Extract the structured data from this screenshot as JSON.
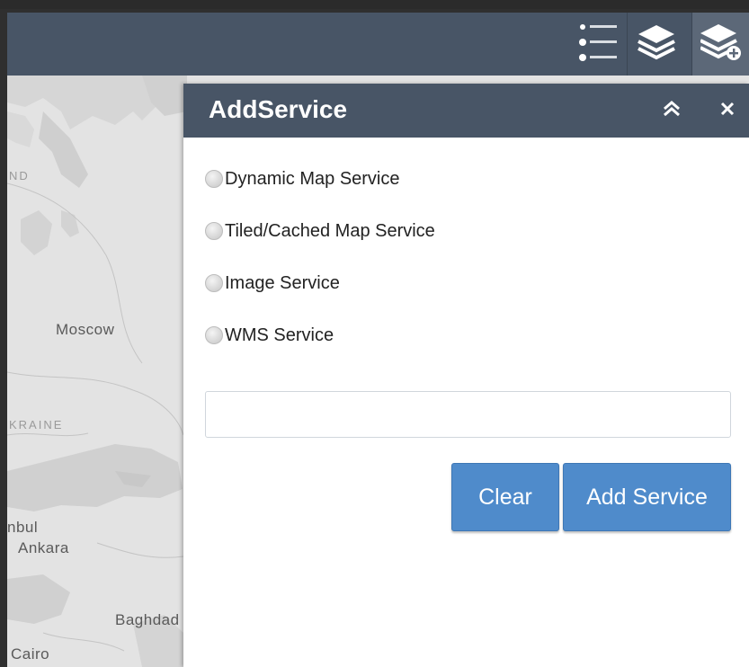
{
  "toolbar": {
    "buttons": [
      {
        "icon": "legend-list-icon"
      },
      {
        "icon": "layers-icon"
      },
      {
        "icon": "add-layer-icon",
        "active": true
      }
    ]
  },
  "map": {
    "labels": [
      "ND",
      "Moscow",
      "KRAINE",
      "nbul",
      "Ankara",
      "Baghdad",
      "Cairo"
    ]
  },
  "panel": {
    "title": "AddService",
    "collapse_icon": "double-chevron-up-icon",
    "close_icon": "close-icon",
    "options": [
      {
        "label": "Dynamic Map Service",
        "selected": false
      },
      {
        "label": "Tiled/Cached Map Service",
        "selected": false
      },
      {
        "label": "Image Service",
        "selected": false
      },
      {
        "label": "WMS Service",
        "selected": false
      }
    ],
    "url_input": {
      "value": "",
      "placeholder": ""
    },
    "clear_label": "Clear",
    "add_label": "Add Service"
  },
  "colors": {
    "header": "#485566",
    "button": "#4f8bcb",
    "map": "#e3e3e3"
  }
}
